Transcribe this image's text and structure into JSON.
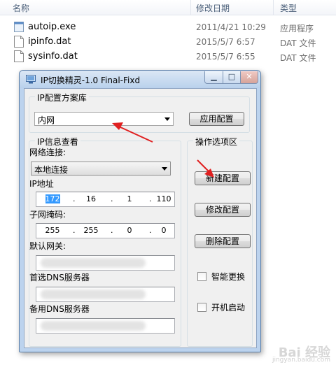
{
  "explorer": {
    "columns": {
      "name": "名称",
      "date": "修改日期",
      "type": "类型"
    },
    "files": [
      {
        "name": "autoip.exe",
        "date": "2011/4/21 10:29",
        "type": "应用程序",
        "icon": "exe-file-icon"
      },
      {
        "name": "ipinfo.dat",
        "date": "2015/5/7 6:57",
        "type": "DAT 文件",
        "icon": "dat-file-icon"
      },
      {
        "name": "sysinfo.dat",
        "date": "2015/5/7 6:55",
        "type": "DAT 文件",
        "icon": "dat-file-icon"
      }
    ]
  },
  "dialog": {
    "title": "IP切换精灵-1.0 Final-Fixd",
    "scheme_group": {
      "label": "IP配置方案库",
      "selected": "内网",
      "apply_button": "应用配置"
    },
    "info_group": {
      "label": "IP信息查看",
      "connection_label": "网络连接:",
      "connection_value": "本地连接",
      "ip_label": "IP地址",
      "ip": [
        "172",
        "16",
        "1",
        "110"
      ],
      "mask_label": "子网掩码:",
      "mask": [
        "255",
        "255",
        "0",
        "0"
      ],
      "gateway_label": "默认网关:",
      "dns1_label": "首选DNS服务器",
      "dns2_label": "备用DNS服务器"
    },
    "ops_group": {
      "label": "操作选项区",
      "new_button": "新建配置",
      "modify_button": "修改配置",
      "delete_button": "删除配置",
      "smart_switch_label": "智能更换",
      "startup_label": "开机启动"
    }
  },
  "watermark": {
    "brand": "Bai 经验",
    "site": "jingyan.baidu.com"
  },
  "colors": {
    "annotation_arrow": "#e02020",
    "title_bar": "#bcd3ee",
    "selection": "#3399ff"
  }
}
